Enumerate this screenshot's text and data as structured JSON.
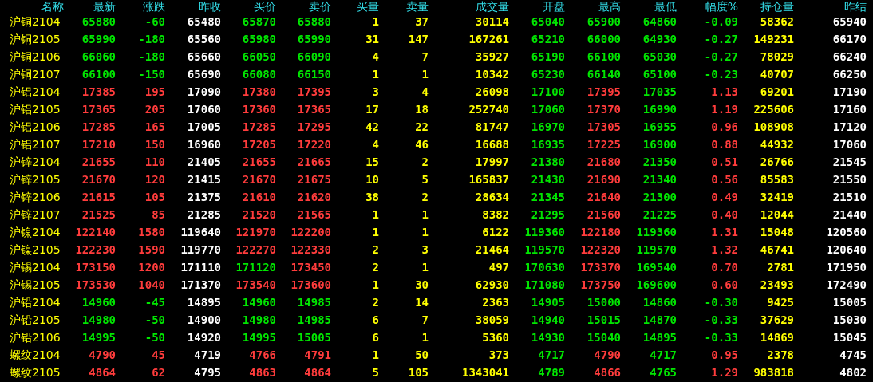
{
  "table": {
    "columns": [
      {
        "label": "名称",
        "kind": "name"
      },
      {
        "label": "最新",
        "kind": "price"
      },
      {
        "label": "涨跌",
        "kind": "price"
      },
      {
        "label": "昨收",
        "kind": "reference"
      },
      {
        "label": "买价",
        "kind": "price"
      },
      {
        "label": "卖价",
        "kind": "price"
      },
      {
        "label": "买量",
        "kind": "volume"
      },
      {
        "label": "卖量",
        "kind": "volume"
      },
      {
        "label": "成交量",
        "kind": "volume"
      },
      {
        "label": "开盘",
        "kind": "price"
      },
      {
        "label": "最高",
        "kind": "price"
      },
      {
        "label": "最低",
        "kind": "price"
      },
      {
        "label": "幅度%",
        "kind": "price"
      },
      {
        "label": "持仓量",
        "kind": "volume"
      },
      {
        "label": "昨结",
        "kind": "reference"
      }
    ],
    "rows": [
      {
        "cells": [
          {
            "text": "沪铜2104"
          },
          {
            "text": "65880",
            "color": "#00e600"
          },
          {
            "text": "-60",
            "color": "#00e600"
          },
          {
            "text": "65480"
          },
          {
            "text": "65870",
            "color": "#00e600"
          },
          {
            "text": "65880",
            "color": "#00e600"
          },
          {
            "text": "1"
          },
          {
            "text": "37"
          },
          {
            "text": "30114"
          },
          {
            "text": "65040",
            "color": "#00e600"
          },
          {
            "text": "65900",
            "color": "#00e600"
          },
          {
            "text": "64860",
            "color": "#00e600"
          },
          {
            "text": "-0.09",
            "color": "#00e600"
          },
          {
            "text": "58362"
          },
          {
            "text": "65940"
          }
        ]
      },
      {
        "cells": [
          {
            "text": "沪铜2105"
          },
          {
            "text": "65990",
            "color": "#00e600"
          },
          {
            "text": "-180",
            "color": "#00e600"
          },
          {
            "text": "65560"
          },
          {
            "text": "65980",
            "color": "#00e600"
          },
          {
            "text": "65990",
            "color": "#00e600"
          },
          {
            "text": "31"
          },
          {
            "text": "147"
          },
          {
            "text": "167261"
          },
          {
            "text": "65210",
            "color": "#00e600"
          },
          {
            "text": "66000",
            "color": "#00e600"
          },
          {
            "text": "64930",
            "color": "#00e600"
          },
          {
            "text": "-0.27",
            "color": "#00e600"
          },
          {
            "text": "149231"
          },
          {
            "text": "66170"
          }
        ]
      },
      {
        "cells": [
          {
            "text": "沪铜2106"
          },
          {
            "text": "66060",
            "color": "#00e600"
          },
          {
            "text": "-180",
            "color": "#00e600"
          },
          {
            "text": "65660"
          },
          {
            "text": "66050",
            "color": "#00e600"
          },
          {
            "text": "66090",
            "color": "#00e600"
          },
          {
            "text": "4"
          },
          {
            "text": "7"
          },
          {
            "text": "35927"
          },
          {
            "text": "65190",
            "color": "#00e600"
          },
          {
            "text": "66100",
            "color": "#00e600"
          },
          {
            "text": "65030",
            "color": "#00e600"
          },
          {
            "text": "-0.27",
            "color": "#00e600"
          },
          {
            "text": "78029"
          },
          {
            "text": "66240"
          }
        ]
      },
      {
        "cells": [
          {
            "text": "沪铜2107"
          },
          {
            "text": "66100",
            "color": "#00e600"
          },
          {
            "text": "-150",
            "color": "#00e600"
          },
          {
            "text": "65690"
          },
          {
            "text": "66080",
            "color": "#00e600"
          },
          {
            "text": "66150",
            "color": "#00e600"
          },
          {
            "text": "1"
          },
          {
            "text": "1"
          },
          {
            "text": "10342"
          },
          {
            "text": "65230",
            "color": "#00e600"
          },
          {
            "text": "66140",
            "color": "#00e600"
          },
          {
            "text": "65100",
            "color": "#00e600"
          },
          {
            "text": "-0.23",
            "color": "#00e600"
          },
          {
            "text": "40707"
          },
          {
            "text": "66250"
          }
        ]
      },
      {
        "cells": [
          {
            "text": "沪铝2104"
          },
          {
            "text": "17385",
            "color": "#ff3c3c"
          },
          {
            "text": "195",
            "color": "#ff3c3c"
          },
          {
            "text": "17090"
          },
          {
            "text": "17380",
            "color": "#ff3c3c"
          },
          {
            "text": "17395",
            "color": "#ff3c3c"
          },
          {
            "text": "3"
          },
          {
            "text": "4"
          },
          {
            "text": "26098"
          },
          {
            "text": "17100",
            "color": "#00e600"
          },
          {
            "text": "17395",
            "color": "#ff3c3c"
          },
          {
            "text": "17035",
            "color": "#00e600"
          },
          {
            "text": "1.13",
            "color": "#ff3c3c"
          },
          {
            "text": "69201"
          },
          {
            "text": "17190"
          }
        ]
      },
      {
        "cells": [
          {
            "text": "沪铝2105"
          },
          {
            "text": "17365",
            "color": "#ff3c3c"
          },
          {
            "text": "205",
            "color": "#ff3c3c"
          },
          {
            "text": "17060"
          },
          {
            "text": "17360",
            "color": "#ff3c3c"
          },
          {
            "text": "17365",
            "color": "#ff3c3c"
          },
          {
            "text": "17"
          },
          {
            "text": "18"
          },
          {
            "text": "252740"
          },
          {
            "text": "17060",
            "color": "#00e600"
          },
          {
            "text": "17370",
            "color": "#ff3c3c"
          },
          {
            "text": "16990",
            "color": "#00e600"
          },
          {
            "text": "1.19",
            "color": "#ff3c3c"
          },
          {
            "text": "225606"
          },
          {
            "text": "17160"
          }
        ]
      },
      {
        "cells": [
          {
            "text": "沪铝2106"
          },
          {
            "text": "17285",
            "color": "#ff3c3c"
          },
          {
            "text": "165",
            "color": "#ff3c3c"
          },
          {
            "text": "17005"
          },
          {
            "text": "17285",
            "color": "#ff3c3c"
          },
          {
            "text": "17295",
            "color": "#ff3c3c"
          },
          {
            "text": "42"
          },
          {
            "text": "22"
          },
          {
            "text": "81747"
          },
          {
            "text": "16970",
            "color": "#00e600"
          },
          {
            "text": "17305",
            "color": "#ff3c3c"
          },
          {
            "text": "16955",
            "color": "#00e600"
          },
          {
            "text": "0.96",
            "color": "#ff3c3c"
          },
          {
            "text": "108908"
          },
          {
            "text": "17120"
          }
        ]
      },
      {
        "cells": [
          {
            "text": "沪铝2107"
          },
          {
            "text": "17210",
            "color": "#ff3c3c"
          },
          {
            "text": "150",
            "color": "#ff3c3c"
          },
          {
            "text": "16960"
          },
          {
            "text": "17205",
            "color": "#ff3c3c"
          },
          {
            "text": "17220",
            "color": "#ff3c3c"
          },
          {
            "text": "4"
          },
          {
            "text": "46"
          },
          {
            "text": "16688"
          },
          {
            "text": "16935",
            "color": "#00e600"
          },
          {
            "text": "17225",
            "color": "#ff3c3c"
          },
          {
            "text": "16900",
            "color": "#00e600"
          },
          {
            "text": "0.88",
            "color": "#ff3c3c"
          },
          {
            "text": "44932"
          },
          {
            "text": "17060"
          }
        ]
      },
      {
        "cells": [
          {
            "text": "沪锌2104"
          },
          {
            "text": "21655",
            "color": "#ff3c3c"
          },
          {
            "text": "110",
            "color": "#ff3c3c"
          },
          {
            "text": "21405"
          },
          {
            "text": "21655",
            "color": "#ff3c3c"
          },
          {
            "text": "21665",
            "color": "#ff3c3c"
          },
          {
            "text": "15"
          },
          {
            "text": "2"
          },
          {
            "text": "17997"
          },
          {
            "text": "21380",
            "color": "#00e600"
          },
          {
            "text": "21680",
            "color": "#ff3c3c"
          },
          {
            "text": "21350",
            "color": "#00e600"
          },
          {
            "text": "0.51",
            "color": "#ff3c3c"
          },
          {
            "text": "26766"
          },
          {
            "text": "21545"
          }
        ]
      },
      {
        "cells": [
          {
            "text": "沪锌2105"
          },
          {
            "text": "21670",
            "color": "#ff3c3c"
          },
          {
            "text": "120",
            "color": "#ff3c3c"
          },
          {
            "text": "21415"
          },
          {
            "text": "21670",
            "color": "#ff3c3c"
          },
          {
            "text": "21675",
            "color": "#ff3c3c"
          },
          {
            "text": "10"
          },
          {
            "text": "5"
          },
          {
            "text": "165837"
          },
          {
            "text": "21430",
            "color": "#00e600"
          },
          {
            "text": "21690",
            "color": "#ff3c3c"
          },
          {
            "text": "21340",
            "color": "#00e600"
          },
          {
            "text": "0.56",
            "color": "#ff3c3c"
          },
          {
            "text": "85583"
          },
          {
            "text": "21550"
          }
        ]
      },
      {
        "cells": [
          {
            "text": "沪锌2106"
          },
          {
            "text": "21615",
            "color": "#ff3c3c"
          },
          {
            "text": "105",
            "color": "#ff3c3c"
          },
          {
            "text": "21375"
          },
          {
            "text": "21610",
            "color": "#ff3c3c"
          },
          {
            "text": "21620",
            "color": "#ff3c3c"
          },
          {
            "text": "38"
          },
          {
            "text": "2"
          },
          {
            "text": "28634"
          },
          {
            "text": "21345",
            "color": "#00e600"
          },
          {
            "text": "21640",
            "color": "#ff3c3c"
          },
          {
            "text": "21300",
            "color": "#00e600"
          },
          {
            "text": "0.49",
            "color": "#ff3c3c"
          },
          {
            "text": "32419"
          },
          {
            "text": "21510"
          }
        ]
      },
      {
        "cells": [
          {
            "text": "沪锌2107"
          },
          {
            "text": "21525",
            "color": "#ff3c3c"
          },
          {
            "text": "85",
            "color": "#ff3c3c"
          },
          {
            "text": "21285"
          },
          {
            "text": "21520",
            "color": "#ff3c3c"
          },
          {
            "text": "21565",
            "color": "#ff3c3c"
          },
          {
            "text": "1"
          },
          {
            "text": "1"
          },
          {
            "text": "8382"
          },
          {
            "text": "21295",
            "color": "#00e600"
          },
          {
            "text": "21560",
            "color": "#ff3c3c"
          },
          {
            "text": "21225",
            "color": "#00e600"
          },
          {
            "text": "0.40",
            "color": "#ff3c3c"
          },
          {
            "text": "12044"
          },
          {
            "text": "21440"
          }
        ]
      },
      {
        "cells": [
          {
            "text": "沪镍2104"
          },
          {
            "text": "122140",
            "color": "#ff3c3c"
          },
          {
            "text": "1580",
            "color": "#ff3c3c"
          },
          {
            "text": "119640"
          },
          {
            "text": "121970",
            "color": "#ff3c3c"
          },
          {
            "text": "122200",
            "color": "#ff3c3c"
          },
          {
            "text": "1"
          },
          {
            "text": "1"
          },
          {
            "text": "6122"
          },
          {
            "text": "119360",
            "color": "#00e600"
          },
          {
            "text": "122180",
            "color": "#ff3c3c"
          },
          {
            "text": "119360",
            "color": "#00e600"
          },
          {
            "text": "1.31",
            "color": "#ff3c3c"
          },
          {
            "text": "15048"
          },
          {
            "text": "120560"
          }
        ]
      },
      {
        "cells": [
          {
            "text": "沪镍2105"
          },
          {
            "text": "122230",
            "color": "#ff3c3c"
          },
          {
            "text": "1590",
            "color": "#ff3c3c"
          },
          {
            "text": "119770"
          },
          {
            "text": "122270",
            "color": "#ff3c3c"
          },
          {
            "text": "122330",
            "color": "#ff3c3c"
          },
          {
            "text": "2"
          },
          {
            "text": "3"
          },
          {
            "text": "21464"
          },
          {
            "text": "119570",
            "color": "#00e600"
          },
          {
            "text": "122320",
            "color": "#ff3c3c"
          },
          {
            "text": "119570",
            "color": "#00e600"
          },
          {
            "text": "1.32",
            "color": "#ff3c3c"
          },
          {
            "text": "46741"
          },
          {
            "text": "120640"
          }
        ]
      },
      {
        "cells": [
          {
            "text": "沪锡2104"
          },
          {
            "text": "173150",
            "color": "#ff3c3c"
          },
          {
            "text": "1200",
            "color": "#ff3c3c"
          },
          {
            "text": "171110"
          },
          {
            "text": "171120",
            "color": "#00e600"
          },
          {
            "text": "173450",
            "color": "#ff3c3c"
          },
          {
            "text": "2"
          },
          {
            "text": "1"
          },
          {
            "text": "497"
          },
          {
            "text": "170630",
            "color": "#00e600"
          },
          {
            "text": "173370",
            "color": "#ff3c3c"
          },
          {
            "text": "169540",
            "color": "#00e600"
          },
          {
            "text": "0.70",
            "color": "#ff3c3c"
          },
          {
            "text": "2781"
          },
          {
            "text": "171950"
          }
        ]
      },
      {
        "cells": [
          {
            "text": "沪锡2105"
          },
          {
            "text": "173530",
            "color": "#ff3c3c"
          },
          {
            "text": "1040",
            "color": "#ff3c3c"
          },
          {
            "text": "171370"
          },
          {
            "text": "173540",
            "color": "#ff3c3c"
          },
          {
            "text": "173600",
            "color": "#ff3c3c"
          },
          {
            "text": "1"
          },
          {
            "text": "30"
          },
          {
            "text": "62930"
          },
          {
            "text": "171080",
            "color": "#00e600"
          },
          {
            "text": "173750",
            "color": "#ff3c3c"
          },
          {
            "text": "169600",
            "color": "#00e600"
          },
          {
            "text": "0.60",
            "color": "#ff3c3c"
          },
          {
            "text": "23493"
          },
          {
            "text": "172490"
          }
        ]
      },
      {
        "cells": [
          {
            "text": "沪铅2104"
          },
          {
            "text": "14960",
            "color": "#00e600"
          },
          {
            "text": "-45",
            "color": "#00e600"
          },
          {
            "text": "14895"
          },
          {
            "text": "14960",
            "color": "#00e600"
          },
          {
            "text": "14985",
            "color": "#00e600"
          },
          {
            "text": "2"
          },
          {
            "text": "14"
          },
          {
            "text": "2363"
          },
          {
            "text": "14905",
            "color": "#00e600"
          },
          {
            "text": "15000",
            "color": "#00e600"
          },
          {
            "text": "14860",
            "color": "#00e600"
          },
          {
            "text": "-0.30",
            "color": "#00e600"
          },
          {
            "text": "9425"
          },
          {
            "text": "15005"
          }
        ]
      },
      {
        "cells": [
          {
            "text": "沪铅2105"
          },
          {
            "text": "14980",
            "color": "#00e600"
          },
          {
            "text": "-50",
            "color": "#00e600"
          },
          {
            "text": "14900"
          },
          {
            "text": "14980",
            "color": "#00e600"
          },
          {
            "text": "14985",
            "color": "#00e600"
          },
          {
            "text": "6"
          },
          {
            "text": "7"
          },
          {
            "text": "38059"
          },
          {
            "text": "14940",
            "color": "#00e600"
          },
          {
            "text": "15015",
            "color": "#00e600"
          },
          {
            "text": "14870",
            "color": "#00e600"
          },
          {
            "text": "-0.33",
            "color": "#00e600"
          },
          {
            "text": "37629"
          },
          {
            "text": "15030"
          }
        ]
      },
      {
        "cells": [
          {
            "text": "沪铅2106"
          },
          {
            "text": "14995",
            "color": "#00e600"
          },
          {
            "text": "-50",
            "color": "#00e600"
          },
          {
            "text": "14920"
          },
          {
            "text": "14995",
            "color": "#00e600"
          },
          {
            "text": "15005",
            "color": "#00e600"
          },
          {
            "text": "6"
          },
          {
            "text": "1"
          },
          {
            "text": "5360"
          },
          {
            "text": "14930",
            "color": "#00e600"
          },
          {
            "text": "15040",
            "color": "#00e600"
          },
          {
            "text": "14895",
            "color": "#00e600"
          },
          {
            "text": "-0.33",
            "color": "#00e600"
          },
          {
            "text": "14869"
          },
          {
            "text": "15045"
          }
        ]
      },
      {
        "cells": [
          {
            "text": "螺纹2104"
          },
          {
            "text": "4790",
            "color": "#ff3c3c"
          },
          {
            "text": "45",
            "color": "#ff3c3c"
          },
          {
            "text": "4719"
          },
          {
            "text": "4766",
            "color": "#ff3c3c"
          },
          {
            "text": "4791",
            "color": "#ff3c3c"
          },
          {
            "text": "1"
          },
          {
            "text": "50"
          },
          {
            "text": "373"
          },
          {
            "text": "4717",
            "color": "#00e600"
          },
          {
            "text": "4790",
            "color": "#ff3c3c"
          },
          {
            "text": "4717",
            "color": "#00e600"
          },
          {
            "text": "0.95",
            "color": "#ff3c3c"
          },
          {
            "text": "2378"
          },
          {
            "text": "4745"
          }
        ]
      },
      {
        "cells": [
          {
            "text": "螺纹2105"
          },
          {
            "text": "4864",
            "color": "#ff3c3c"
          },
          {
            "text": "62",
            "color": "#ff3c3c"
          },
          {
            "text": "4795"
          },
          {
            "text": "4863",
            "color": "#ff3c3c"
          },
          {
            "text": "4864",
            "color": "#ff3c3c"
          },
          {
            "text": "5"
          },
          {
            "text": "105"
          },
          {
            "text": "1343041"
          },
          {
            "text": "4789",
            "color": "#00e600"
          },
          {
            "text": "4866",
            "color": "#ff3c3c"
          },
          {
            "text": "4765",
            "color": "#00e600"
          },
          {
            "text": "1.29",
            "color": "#ff3c3c"
          },
          {
            "text": "983818"
          },
          {
            "text": "4802"
          }
        ]
      }
    ]
  }
}
